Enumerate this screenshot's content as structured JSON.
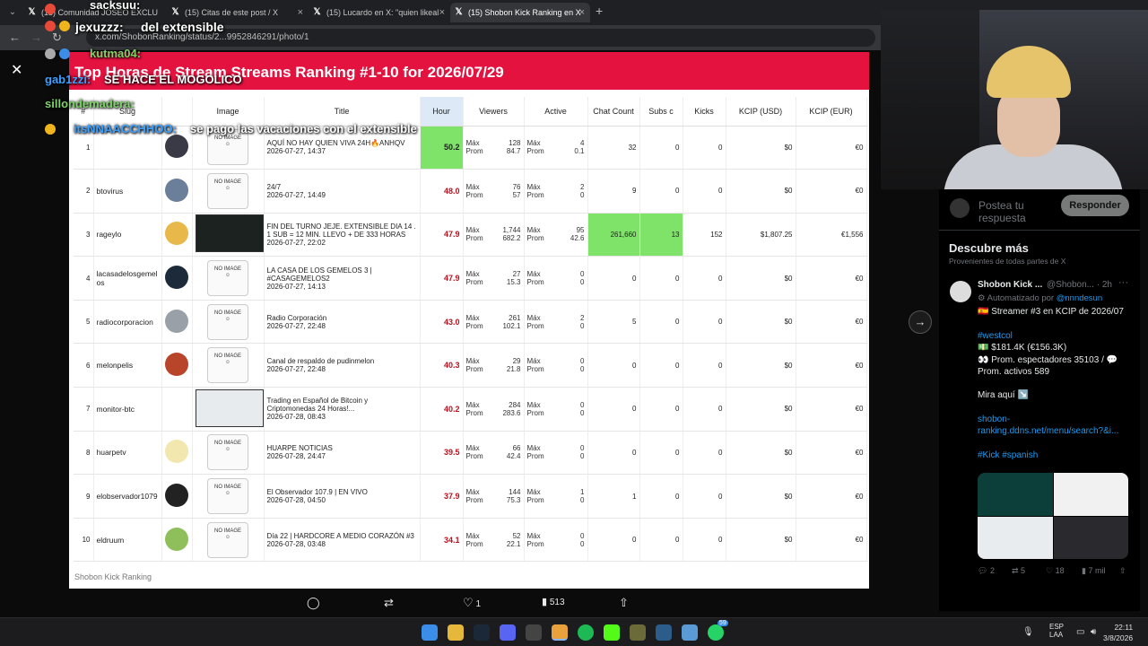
{
  "browser": {
    "tabs": [
      {
        "label": "(13) Comunidad JOSEO EXCLU",
        "icon": "x-logo-icon"
      },
      {
        "label": "(15) Citas de este post / X",
        "icon": "x-logo-icon"
      },
      {
        "label": "(15) Lucardo en X: \"quien likeal",
        "icon": "x-logo-icon"
      },
      {
        "label": "(15) Shobon Kick Ranking en X",
        "icon": "x-logo-icon",
        "active": true
      }
    ],
    "new_tab": "+",
    "tab_close": "×",
    "url": "x.com/ShobonRanking/status/2...9952846291/photo/1"
  },
  "viewer": {
    "close": "✕",
    "next": "→"
  },
  "ranking": {
    "title": "Top Horas de Stream Streams Ranking #1-10 for 2026/07/29",
    "footer": "Shobon Kick Ranking",
    "headers": [
      "#",
      "Slug",
      "Image",
      "Title",
      "Hour",
      "Viewers",
      "Active",
      "Chat Count",
      "Subs c",
      "Kicks",
      "KCIP (USD)",
      "KCIP (EUR)"
    ],
    "mp_labels": [
      "Máx",
      "Prom"
    ],
    "no_image_label": "NO IMAGE",
    "rows": [
      {
        "rank": "1",
        "slug": "",
        "image": "none",
        "title": "AQUÍ NO HAY QUIEN VIVA 24H🔥ANHQV",
        "date": "2026-07-27, 14:37",
        "hour": "50.2",
        "hour_hl": true,
        "viewers_max": "128",
        "viewers_avg": "84.7",
        "active_max": "4",
        "active_avg": "0.1",
        "chat": "32",
        "subs": "0",
        "kicks": "0",
        "usd": "$0",
        "eur": "€0",
        "avatar_color": "#3a3a46"
      },
      {
        "rank": "2",
        "slug": "btovirus",
        "image": "none",
        "title": "24/7",
        "date": "2026-07-27, 14:49",
        "hour": "48.0",
        "hour_hl": false,
        "viewers_max": "76",
        "viewers_avg": "57",
        "active_max": "2",
        "active_avg": "0",
        "chat": "9",
        "subs": "0",
        "kicks": "0",
        "usd": "$0",
        "eur": "€0",
        "avatar_color": "#6b7f9a"
      },
      {
        "rank": "3",
        "slug": "rageylo",
        "image": "dark",
        "title": "FIN DEL TURNO JEJE. EXTENSIBLE DIA 14 . 1 SUB = 12 MIN. LLEVO + DE 333 HORAS",
        "date": "2026-07-27, 22:02",
        "hour": "47.9",
        "hour_hl": false,
        "viewers_max": "1,744",
        "viewers_avg": "682.2",
        "active_max": "95",
        "active_avg": "42.6",
        "chat": "261,660",
        "subs": "13",
        "kicks": "152",
        "usd": "$1,807.25",
        "eur": "€1,556",
        "chat_hl": true,
        "subs_hl": true,
        "avatar_color": "#e8b84a"
      },
      {
        "rank": "4",
        "slug": "lacasadelosgemelos",
        "image": "none",
        "title": "LA CASA DE LOS GEMELOS 3 | #CASAGEMELOS2",
        "date": "2026-07-27, 14:13",
        "hour": "47.9",
        "hour_hl": false,
        "viewers_max": "27",
        "viewers_avg": "15.3",
        "active_max": "0",
        "active_avg": "0",
        "chat": "0",
        "subs": "0",
        "kicks": "0",
        "usd": "$0",
        "eur": "€0",
        "avatar_color": "#1d2a3a"
      },
      {
        "rank": "5",
        "slug": "radiocorporacion",
        "image": "none",
        "title": "Radio Corporación",
        "date": "2026-07-27, 22:48",
        "hour": "43.0",
        "hour_hl": false,
        "viewers_max": "261",
        "viewers_avg": "102.1",
        "active_max": "2",
        "active_avg": "0",
        "chat": "5",
        "subs": "0",
        "kicks": "0",
        "usd": "$0",
        "eur": "€0",
        "avatar_color": "#9aa0a8"
      },
      {
        "rank": "6",
        "slug": "melonpelis",
        "image": "none",
        "title": "Canal de respaldo de pudinmelon",
        "date": "2026-07-27, 22:48",
        "hour": "40.3",
        "hour_hl": false,
        "viewers_max": "29",
        "viewers_avg": "21.8",
        "active_max": "0",
        "active_avg": "0",
        "chat": "0",
        "subs": "0",
        "kicks": "0",
        "usd": "$0",
        "eur": "€0",
        "avatar_color": "#b8442a"
      },
      {
        "rank": "7",
        "slug": "monitor-btc",
        "image": "light",
        "title": "Trading en Español de Bitcoin y Criptomonedas 24 Horas!...",
        "date": "2026-07-28, 08:43",
        "hour": "40.2",
        "hour_hl": false,
        "viewers_max": "284",
        "viewers_avg": "283.6",
        "active_max": "0",
        "active_avg": "0",
        "chat": "0",
        "subs": "0",
        "kicks": "0",
        "usd": "$0",
        "eur": "€0",
        "avatar_color": "#ffffff"
      },
      {
        "rank": "8",
        "slug": "huarpetv",
        "image": "none",
        "title": "HUARPE NOTICIAS",
        "date": "2026-07-28, 24:47",
        "hour": "39.5",
        "hour_hl": false,
        "viewers_max": "66",
        "viewers_avg": "42.4",
        "active_max": "0",
        "active_avg": "0",
        "chat": "0",
        "subs": "0",
        "kicks": "0",
        "usd": "$0",
        "eur": "€0",
        "avatar_color": "#f3e7b0"
      },
      {
        "rank": "9",
        "slug": "elobservador1079",
        "image": "none",
        "title": "El Observador 107.9 | EN VIVO",
        "date": "2026-07-28, 04:50",
        "hour": "37.9",
        "hour_hl": false,
        "viewers_max": "144",
        "viewers_avg": "75.3",
        "active_max": "1",
        "active_avg": "0",
        "chat": "1",
        "subs": "0",
        "kicks": "0",
        "usd": "$0",
        "eur": "€0",
        "avatar_color": "#222222"
      },
      {
        "rank": "10",
        "slug": "eldruum",
        "image": "none",
        "title": "Día 22 | HARDCORE A MEDIO CORAZÓN #3",
        "date": "2026-07-28, 03:48",
        "hour": "34.1",
        "hour_hl": false,
        "viewers_max": "52",
        "viewers_avg": "22.1",
        "active_max": "0",
        "active_avg": "0",
        "chat": "0",
        "subs": "0",
        "kicks": "0",
        "usd": "$0",
        "eur": "€0",
        "avatar_color": "#8fbf5a"
      }
    ]
  },
  "chat_overlay": [
    {
      "user": "sacksuu:",
      "message": "",
      "color": "#ffffff"
    },
    {
      "user": "jexuzzz:",
      "message": "del extensible",
      "color": "#ffffff"
    },
    {
      "user": "kutma04:",
      "message": "",
      "color": "#7fd16a"
    },
    {
      "user": "gab1zzi:",
      "message": "SE HACE EL MOGOLICO",
      "color": "#3aa0ff"
    },
    {
      "user": "sillondemadera:",
      "message": "",
      "color": "#7fd16a"
    },
    {
      "user": "itsNNAACCHHOO:",
      "message": "se pago las vacaciones con el extensible",
      "color": "#3aa0ff"
    }
  ],
  "sidebar": {
    "reply_placeholder": "Postea tu respuesta",
    "reply_button": "Responder",
    "discover_title": "Descubre más",
    "discover_sub": "Provenientes de todas partes de X",
    "post": {
      "name": "Shobon Kick ...",
      "handle": "@Shobon...",
      "time": "· 2h",
      "more": "···",
      "auto_prefix": "Automatizado por",
      "auto_link": "@nnndesun",
      "line1": "🇪🇸 Streamer #3 en KCIP de 2026/07",
      "hashtag1": "#westcol",
      "line2": "💵 $181.4K (€156.3K)",
      "line3": "👀 Prom. espectadores 35103 / 💬",
      "line4": "Prom. activos 589",
      "line5": "Mira aquí ↘️",
      "link1": "shobon-",
      "link2": "ranking.ddns.net/menu/search?&i...",
      "hashtags2": "#Kick #spanish",
      "replies": "2",
      "reposts": "5",
      "likes": "18",
      "views": "7 mil"
    }
  },
  "action_bar": {
    "likes": "1",
    "views": "513"
  },
  "taskbar": {
    "lang_top": "ESP",
    "lang_bottom": "LAA",
    "time": "22:11",
    "date": "3/8/2026",
    "badge": "59"
  }
}
